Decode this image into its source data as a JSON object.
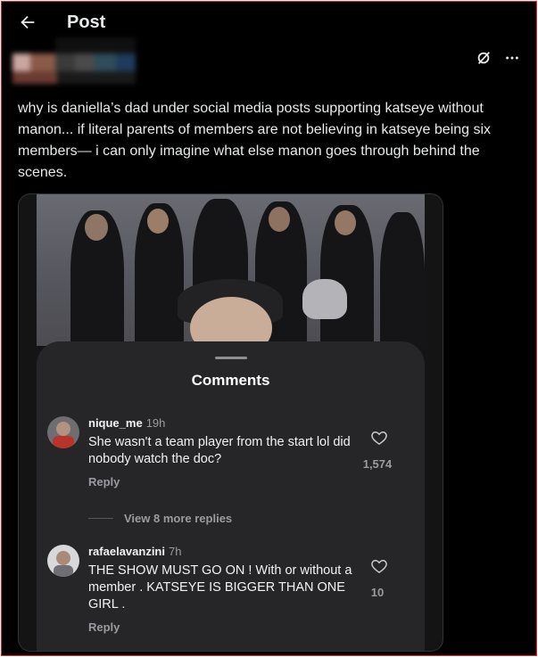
{
  "header": {
    "title": "Post"
  },
  "post": {
    "text": "why is daniella’s dad under social media posts supporting katseye without manon... if literal parents of members are not believing in katseye being six members— i can only imagine what else manon goes through behind the scenes."
  },
  "comments_panel": {
    "title": "Comments",
    "view_more": "View 8 more replies",
    "comments": [
      {
        "user": "nique_me",
        "time": "19h",
        "text": "She wasn't a team player from the start lol did nobody watch the doc?",
        "reply": "Reply",
        "likes": "1,574"
      },
      {
        "user": "rafaelavanzini",
        "time": "7h",
        "text": "THE SHOW MUST GO ON ! With or without a member . KATSEYE IS BIGGER THAN ONE GIRL .",
        "reply": "Reply",
        "likes": "10"
      }
    ]
  },
  "colors": {
    "background": "#000000",
    "text": "#e7e9ea",
    "sheet": "#262629",
    "border_highlight": "#e0262b"
  },
  "icons": [
    "back-arrow-icon",
    "grok-icon",
    "more-icon",
    "heart-icon"
  ]
}
